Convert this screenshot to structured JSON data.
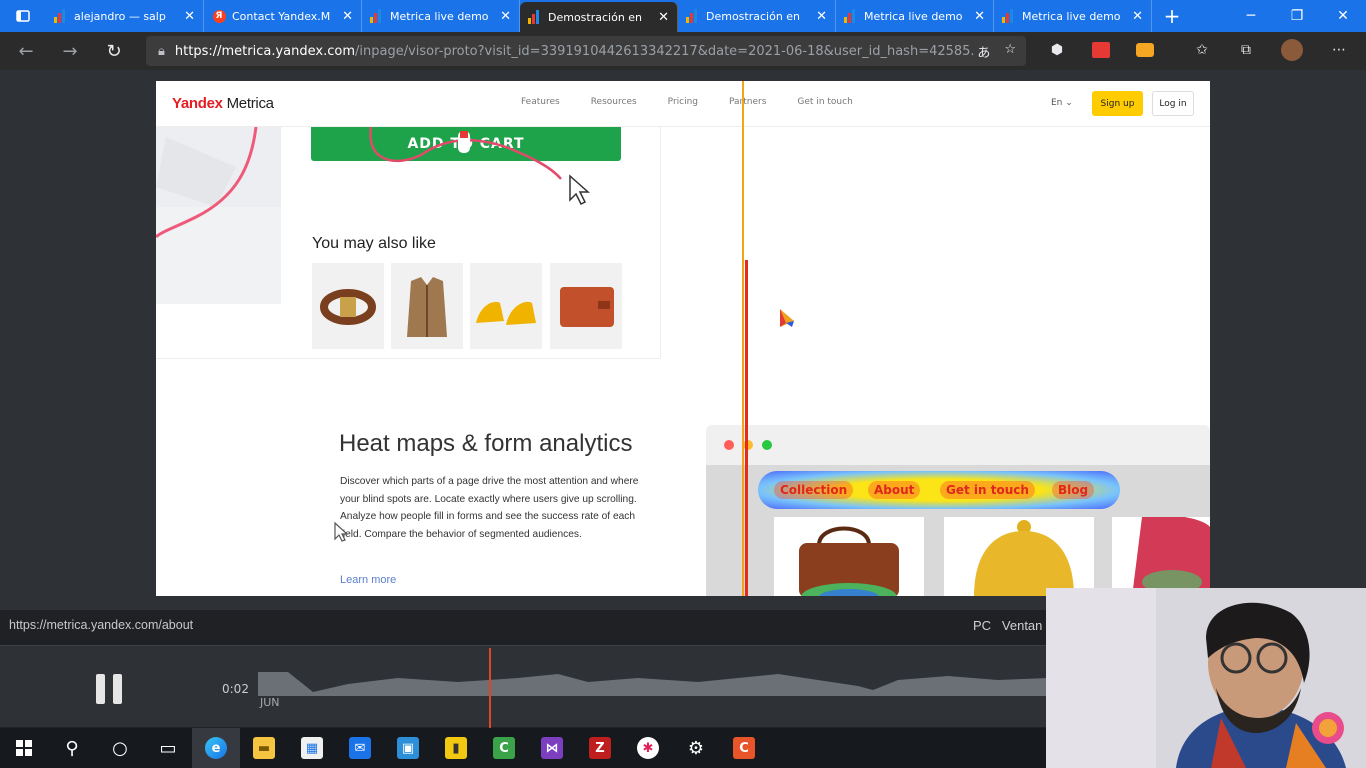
{
  "browser": {
    "tabs": [
      {
        "title": "alejandro — salp",
        "icon": "metrica-chart-icon"
      },
      {
        "title": "Contact Yandex.M",
        "icon": "yandex-icon"
      },
      {
        "title": "Metrica live demo",
        "icon": "metrica-chart-icon"
      },
      {
        "title": "Demostración en",
        "icon": "metrica-chart-icon",
        "active": true
      },
      {
        "title": "Demostración en",
        "icon": "metrica-chart-icon"
      },
      {
        "title": "Metrica live demo",
        "icon": "metrica-chart-icon"
      },
      {
        "title": "Metrica live demo",
        "icon": "metrica-chart-icon"
      }
    ],
    "url_host": "https://metrica.yandex.com",
    "url_path": "/inpage/visor-proto?visit_id=3391910442613342217&date=2021-06-18&user_id_hash=42585...",
    "accent": "#1a73e8"
  },
  "site": {
    "logo_yandex": "Yandex",
    "logo_metrica": "Metrica",
    "menu": [
      "Features",
      "Resources",
      "Pricing",
      "Partners",
      "Get in touch"
    ],
    "lang": "En",
    "signup": "Sign up",
    "login": "Log in",
    "add_to_cart": "ADD TO CART",
    "also_like": "You may also like",
    "feature_title": "Heat maps & form analytics",
    "feature_desc": "Discover which parts of a page drive the most attention and where your blind spots are. Locate exactly where users give up scrolling. Analyze how people fill in forms and see the success rate of each field. Compare the behavior of segmented audiences.",
    "learn_more": "Learn more",
    "heatmap_labels": [
      "Collection",
      "About",
      "Get in touch",
      "Blog"
    ],
    "brand_color": "#ffcc00",
    "cart_color": "#1fa34a"
  },
  "player": {
    "current_url": "https://metrica.yandex.com/about",
    "device": "PC",
    "window_label": "Ventan",
    "time": "0:02",
    "month": "JUN",
    "progress_color": "#e0452b"
  },
  "taskbar": {
    "icons": [
      "windows-start-icon",
      "search-icon",
      "cortana-icon",
      "task-view-icon",
      "edge-icon",
      "file-explorer-icon",
      "store-icon",
      "mail-icon",
      "remote-desktop-icon",
      "power-bi-icon",
      "camtasia-icon",
      "visual-studio-icon",
      "filezilla-icon",
      "slack-icon",
      "settings-icon",
      "camtasia-recorder-icon"
    ]
  }
}
